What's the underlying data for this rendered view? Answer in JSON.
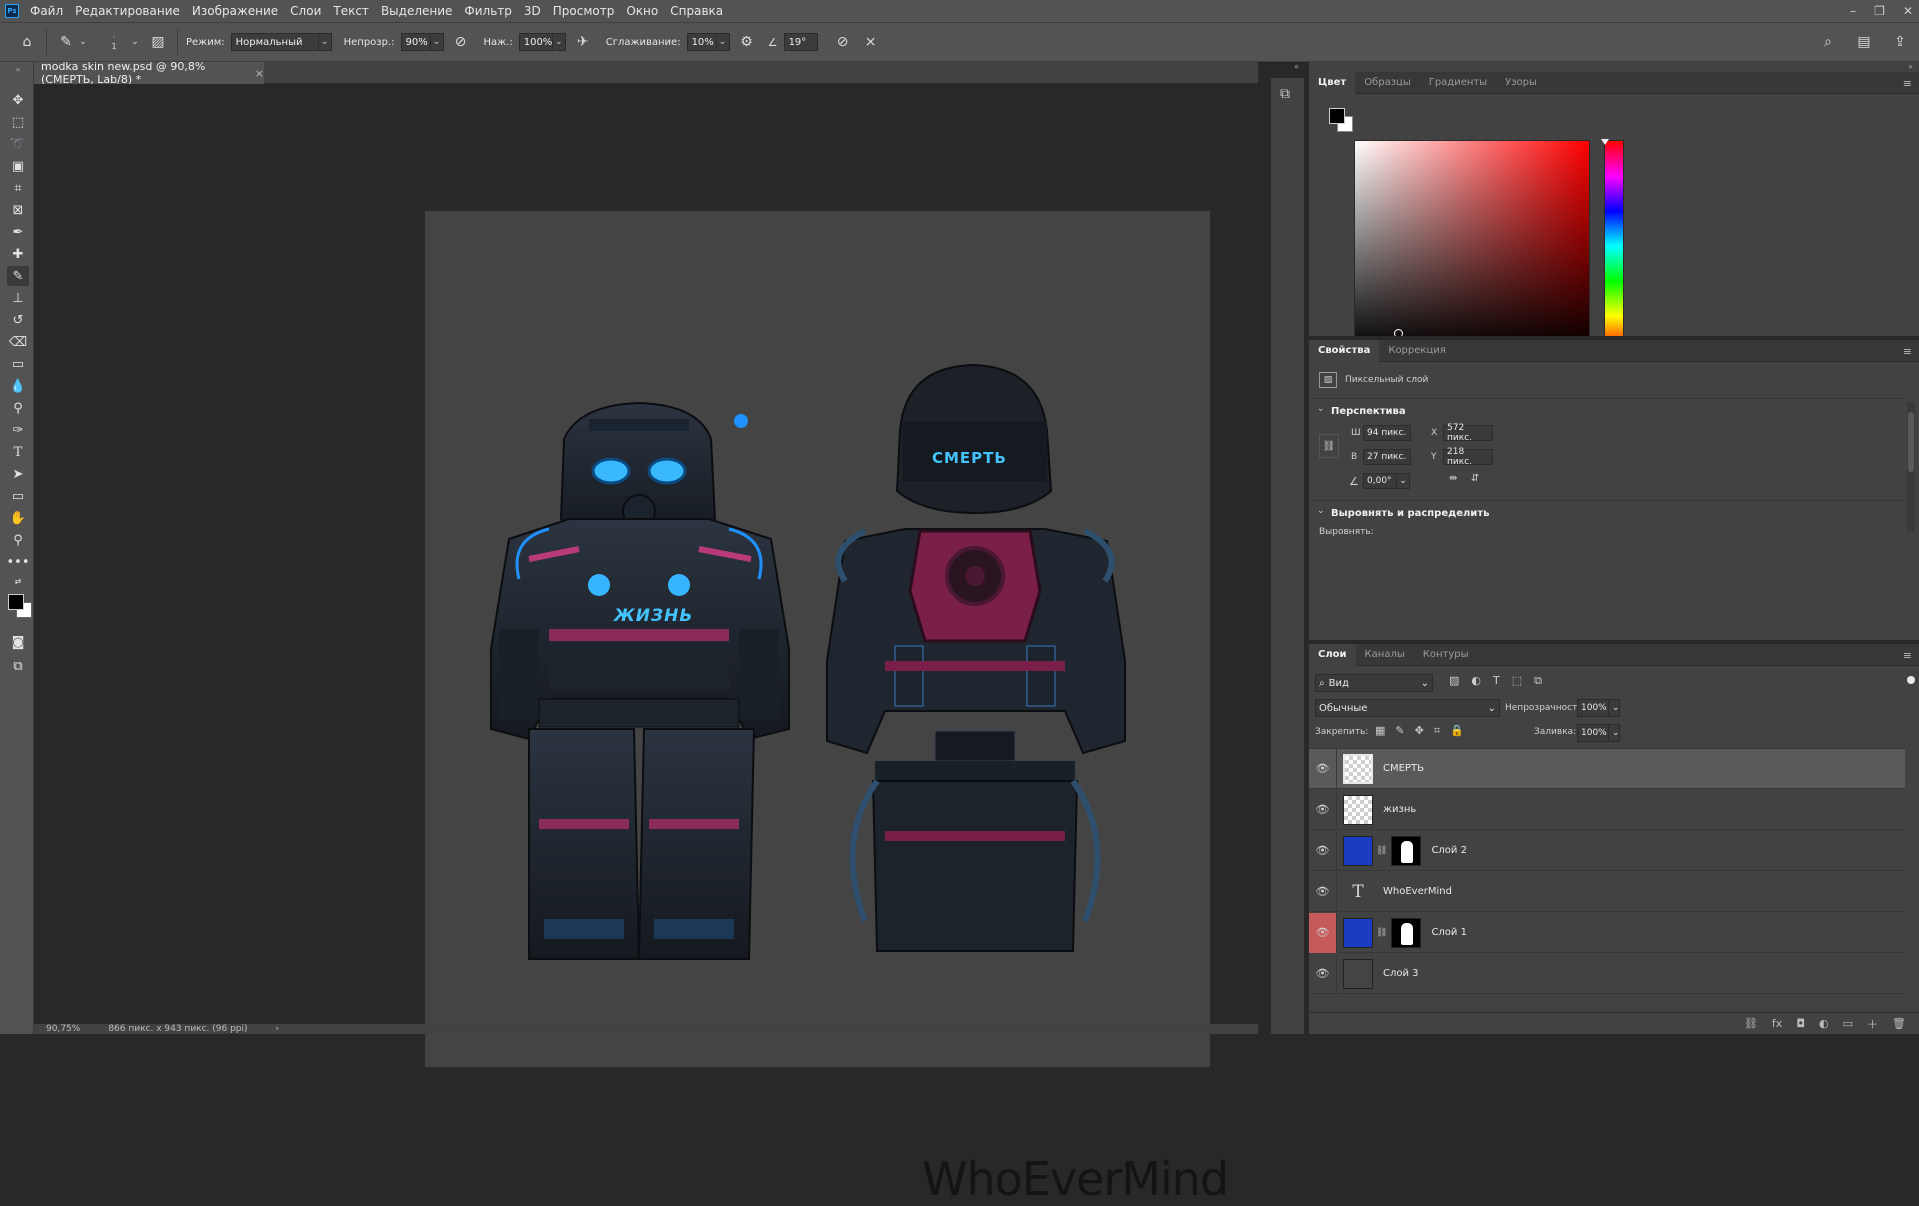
{
  "app": {
    "menu": [
      "Файл",
      "Редактирование",
      "Изображение",
      "Слои",
      "Текст",
      "Выделение",
      "Фильтр",
      "3D",
      "Просмотр",
      "Окно",
      "Справка"
    ],
    "window_controls": [
      "–",
      "❐",
      "✕"
    ]
  },
  "options": {
    "brush_size": "1",
    "mode_label": "Режим:",
    "mode_value": "Нормальный",
    "opacity_label": "Непрозр.:",
    "opacity_value": "90%",
    "pressure_label": "Наж.:",
    "pressure_value": "100%",
    "smoothing_label": "Сглаживание:",
    "smoothing_value": "10%",
    "angle_value": "19°"
  },
  "document": {
    "tab_title": "modka skin new.psd @ 90,8% (СМЕРТЬ, Lab/8) *",
    "close": "×",
    "front_label": "ЖИЗНЬ",
    "back_label": "СМЕРТЬ",
    "watermark": "WhoEverMind"
  },
  "status": {
    "zoom": "90,75%",
    "doc_info": "866 пикс. x 943 пикс. (96 ppi)",
    "arrow": "›"
  },
  "color_panel": {
    "tabs": [
      "Цвет",
      "Образцы",
      "Градиенты",
      "Узоры"
    ],
    "foreground": "#000000",
    "background": "#ffffff",
    "hue_color": "#ff0000"
  },
  "properties_panel": {
    "tabs": [
      "Свойства",
      "Коррекция"
    ],
    "layer_type": "Пиксельный слой",
    "perspective_title": "Перспектива",
    "w_label": "Ш",
    "w_value": "94 пикс.",
    "h_label": "В",
    "h_value": "27 пикс.",
    "x_label": "X",
    "x_value": "572 пикс.",
    "y_label": "Y",
    "y_value": "218 пикс.",
    "angle_value": "0,00°",
    "align_title": "Выровнять и распределить",
    "align_label": "Выровнять:"
  },
  "layers_panel": {
    "tabs": [
      "Слои",
      "Каналы",
      "Контуры"
    ],
    "filter_value": "Вид",
    "blend_value": "Обычные",
    "opacity_label": "Непрозрачность:",
    "opacity_value": "100%",
    "lock_label": "Закрепить:",
    "fill_label": "Заливка:",
    "fill_value": "100%",
    "layers": [
      {
        "name": "СМЕРТЬ",
        "selected": true
      },
      {
        "name": "жизнь",
        "selected": false
      },
      {
        "name": "Слой 2",
        "selected": false
      },
      {
        "name": "WhoEverMind",
        "selected": false
      },
      {
        "name": "Слой 1",
        "selected": false
      },
      {
        "name": "Слой 3",
        "selected": false
      }
    ],
    "footer": [
      "⛓",
      "fx",
      "◘",
      "◐",
      "▭",
      "＋",
      "🗑"
    ]
  }
}
